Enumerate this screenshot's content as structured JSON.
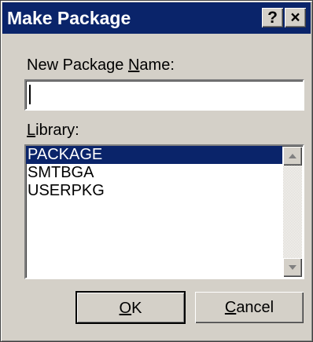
{
  "window": {
    "title": "Make Package",
    "help_button": "?",
    "close_button": "×"
  },
  "name_field": {
    "label_pre": "New Package ",
    "label_accel": "N",
    "label_post": "ame:",
    "value": ""
  },
  "library": {
    "label_accel": "L",
    "label_post": "ibrary:",
    "items": [
      {
        "label": "PACKAGE",
        "selected": true
      },
      {
        "label": "SMTBGA",
        "selected": false
      },
      {
        "label": "USERPKG",
        "selected": false
      }
    ],
    "scroll_up_icon": "triangle-up",
    "scroll_down_icon": "triangle-down"
  },
  "buttons": {
    "ok_accel": "O",
    "ok_post": "K",
    "cancel_accel": "C",
    "cancel_post": "ancel"
  },
  "colors": {
    "titlebar": "#0a246a",
    "dialog_face": "#d4d0c8",
    "selection": "#0a246a"
  }
}
